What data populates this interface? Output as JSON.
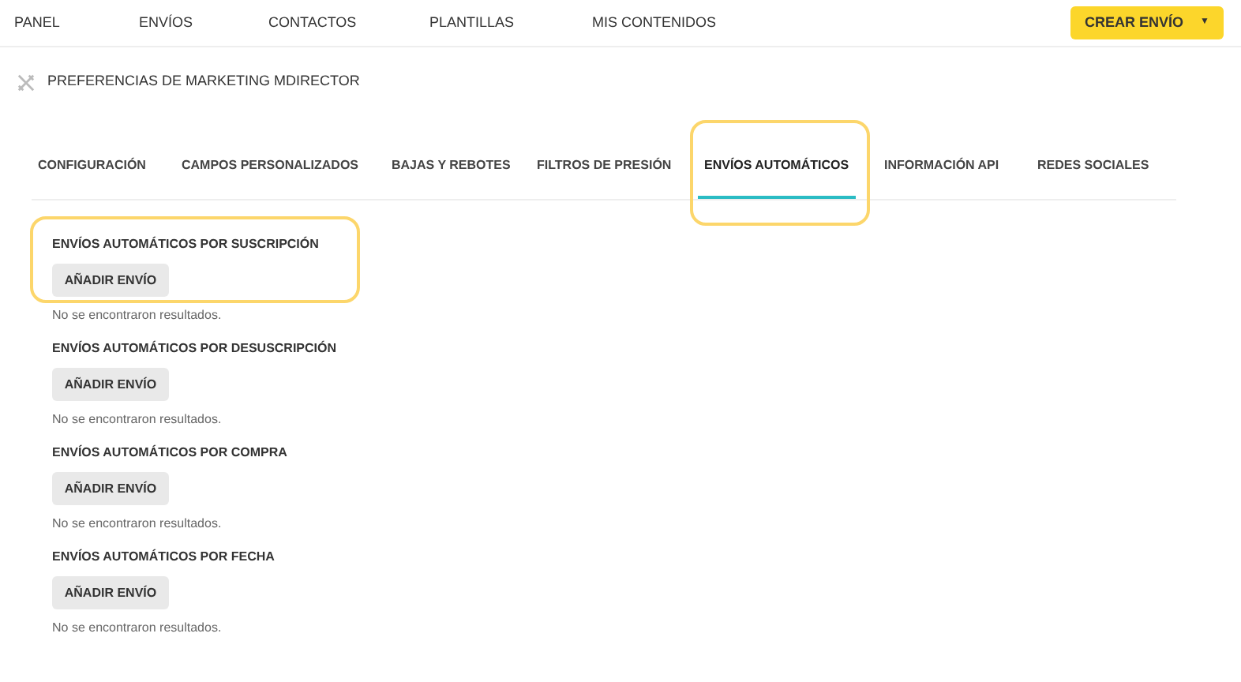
{
  "nav": {
    "items": [
      {
        "label": "PANEL"
      },
      {
        "label": "ENVÍOS"
      },
      {
        "label": "CONTACTOS"
      },
      {
        "label": "PLANTILLAS"
      },
      {
        "label": "MIS CONTENIDOS"
      }
    ],
    "create_button": {
      "label": "CREAR ENVÍO",
      "caret": "▼"
    }
  },
  "page_title": "PREFERENCIAS DE MARKETING MDIRECTOR",
  "tabs": [
    {
      "label": "CONFIGURACIÓN",
      "selected": false,
      "highlighted": false
    },
    {
      "label": "CAMPOS PERSONALIZADOS",
      "selected": false,
      "highlighted": false
    },
    {
      "label": "BAJAS Y REBOTES",
      "selected": false,
      "highlighted": false
    },
    {
      "label": "FILTROS DE PRESIÓN",
      "selected": false,
      "highlighted": false
    },
    {
      "label": "ENVÍOS AUTOMÁTICOS",
      "selected": true,
      "highlighted": true
    },
    {
      "label": "INFORMACIÓN API",
      "selected": false,
      "highlighted": false
    },
    {
      "label": "REDES SOCIALES",
      "selected": false,
      "highlighted": false
    }
  ],
  "sections": [
    {
      "title": "ENVÍOS AUTOMÁTICOS POR SUSCRIPCIÓN",
      "button": "AÑADIR ENVÍO",
      "empty_message": "No se encontraron resultados.",
      "highlighted": true
    },
    {
      "title": "ENVÍOS AUTOMÁTICOS POR DESUSCRIPCIÓN",
      "button": "AÑADIR ENVÍO",
      "empty_message": "No se encontraron resultados.",
      "highlighted": false
    },
    {
      "title": "ENVÍOS AUTOMÁTICOS POR COMPRA",
      "button": "AÑADIR ENVÍO",
      "empty_message": "No se encontraron resultados.",
      "highlighted": false
    },
    {
      "title": "ENVÍOS AUTOMÁTICOS POR FECHA",
      "button": "AÑADIR ENVÍO",
      "empty_message": "No se encontraron resultados.",
      "highlighted": false
    }
  ]
}
